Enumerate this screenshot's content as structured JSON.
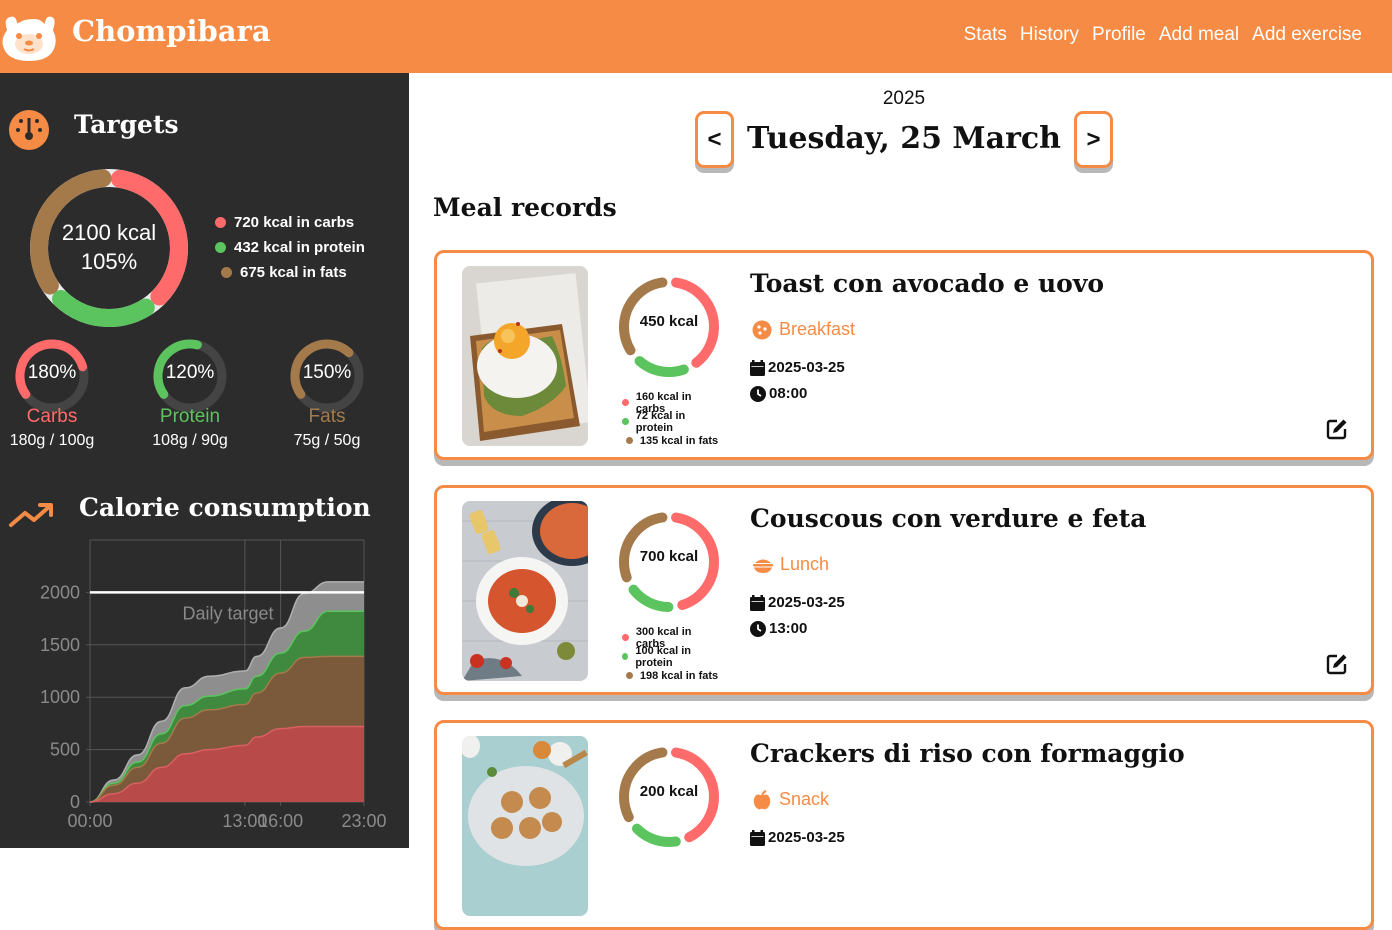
{
  "app": {
    "name": "Chompibara"
  },
  "nav": {
    "items": [
      "Stats",
      "History",
      "Profile",
      "Add meal",
      "Add exercise"
    ]
  },
  "colors": {
    "accent": "#f68b45",
    "carbs": "#ff6b6b",
    "protein": "#5cc45e",
    "fats": "#a57a4b",
    "sidebar": "#2d2c2c"
  },
  "targets": {
    "title": "Targets",
    "icon": "gauge-icon",
    "total_kcal": "2100 kcal",
    "total_pct": "105%",
    "legend": [
      "720 kcal in carbs",
      "432 kcal in protein",
      "675 kcal in fats"
    ],
    "macros": [
      {
        "pct": "180%",
        "name": "Carbs",
        "amount": "180g / 100g",
        "fraction": 1.8
      },
      {
        "pct": "120%",
        "name": "Protein",
        "amount": "108g / 90g",
        "fraction": 1.2
      },
      {
        "pct": "150%",
        "name": "Fats",
        "amount": "75g / 50g",
        "fraction": 1.5
      }
    ]
  },
  "calorie_section": {
    "title": "Calorie consumption",
    "icon": "trending-up-icon"
  },
  "chart_data": {
    "type": "area",
    "x": [
      "00:00",
      "02:00",
      "04:00",
      "06:00",
      "08:00",
      "10:00",
      "13:00",
      "14:00",
      "16:00",
      "18:00",
      "20:00",
      "21:00",
      "22:00",
      "23:00"
    ],
    "xticks": [
      "00:00",
      "13:00",
      "16:00",
      "23:00"
    ],
    "yticks": [
      0,
      500,
      1000,
      1500,
      2000
    ],
    "ylim": [
      0,
      2500
    ],
    "target_label": "Daily target",
    "target_value": 2000,
    "series": [
      {
        "values": [
          0,
          80,
          180,
          330,
          460,
          500,
          540,
          620,
          700,
          720,
          720,
          720,
          720,
          720
        ]
      },
      {
        "values": [
          0,
          160,
          330,
          560,
          800,
          880,
          930,
          1040,
          1230,
          1380,
          1390,
          1390,
          1390,
          1390
        ]
      },
      {
        "values": [
          0,
          180,
          380,
          650,
          920,
          1010,
          1080,
          1200,
          1420,
          1630,
          1820,
          1820,
          1820,
          1820
        ]
      },
      {
        "values": [
          0,
          210,
          450,
          770,
          1090,
          1200,
          1250,
          1390,
          1660,
          1990,
          2100,
          2100,
          2100,
          2100
        ]
      }
    ]
  },
  "day": {
    "year": "2025",
    "date": "Tuesday, 25 March",
    "prev_label": "<",
    "next_label": ">"
  },
  "meals": {
    "heading": "Meal records",
    "items": [
      {
        "title": "Toast con avocado e uovo",
        "type": "Breakfast",
        "type_icon": "cookie-icon",
        "date": "2025-03-25",
        "time": "08:00",
        "kcal": "450 kcal",
        "legend": [
          "160 kcal in carbs",
          "72 kcal in protein",
          "135 kcal in fats"
        ],
        "carbs": 160,
        "protein": 72,
        "fats": 135
      },
      {
        "title": "Couscous con verdure e feta",
        "type": "Lunch",
        "type_icon": "bowl-icon",
        "date": "2025-03-25",
        "time": "13:00",
        "kcal": "700 kcal",
        "legend": [
          "300 kcal in carbs",
          "100 kcal in protein",
          "198 kcal in fats"
        ],
        "carbs": 300,
        "protein": 100,
        "fats": 198
      },
      {
        "title": "Crackers di riso con formaggio",
        "type": "Snack",
        "type_icon": "apple-icon",
        "date": "2025-03-25",
        "time": "",
        "kcal": "200 kcal",
        "legend": [
          "",
          "",
          ""
        ],
        "carbs": 80,
        "protein": 30,
        "fats": 60
      }
    ]
  }
}
